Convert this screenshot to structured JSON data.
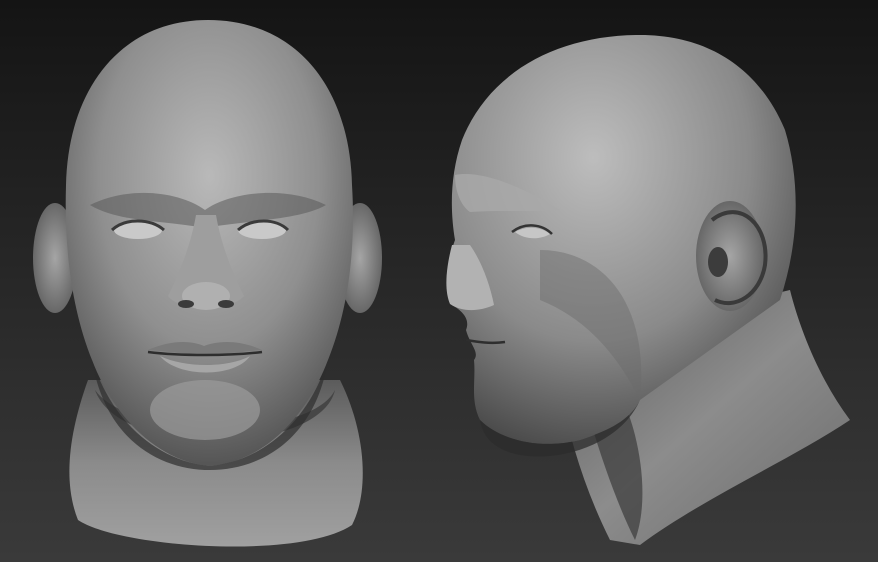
{
  "scene": {
    "views": [
      {
        "name": "front-view",
        "label": ""
      },
      {
        "name": "side-view",
        "label": ""
      }
    ],
    "colors": {
      "background_top": "#141414",
      "background_bottom": "#3a3a3a",
      "clay_light": "#b9b9b9",
      "clay_mid": "#8d8d8d",
      "clay_dark": "#4a4a4a",
      "clay_shadow": "#2b2b2b"
    }
  }
}
